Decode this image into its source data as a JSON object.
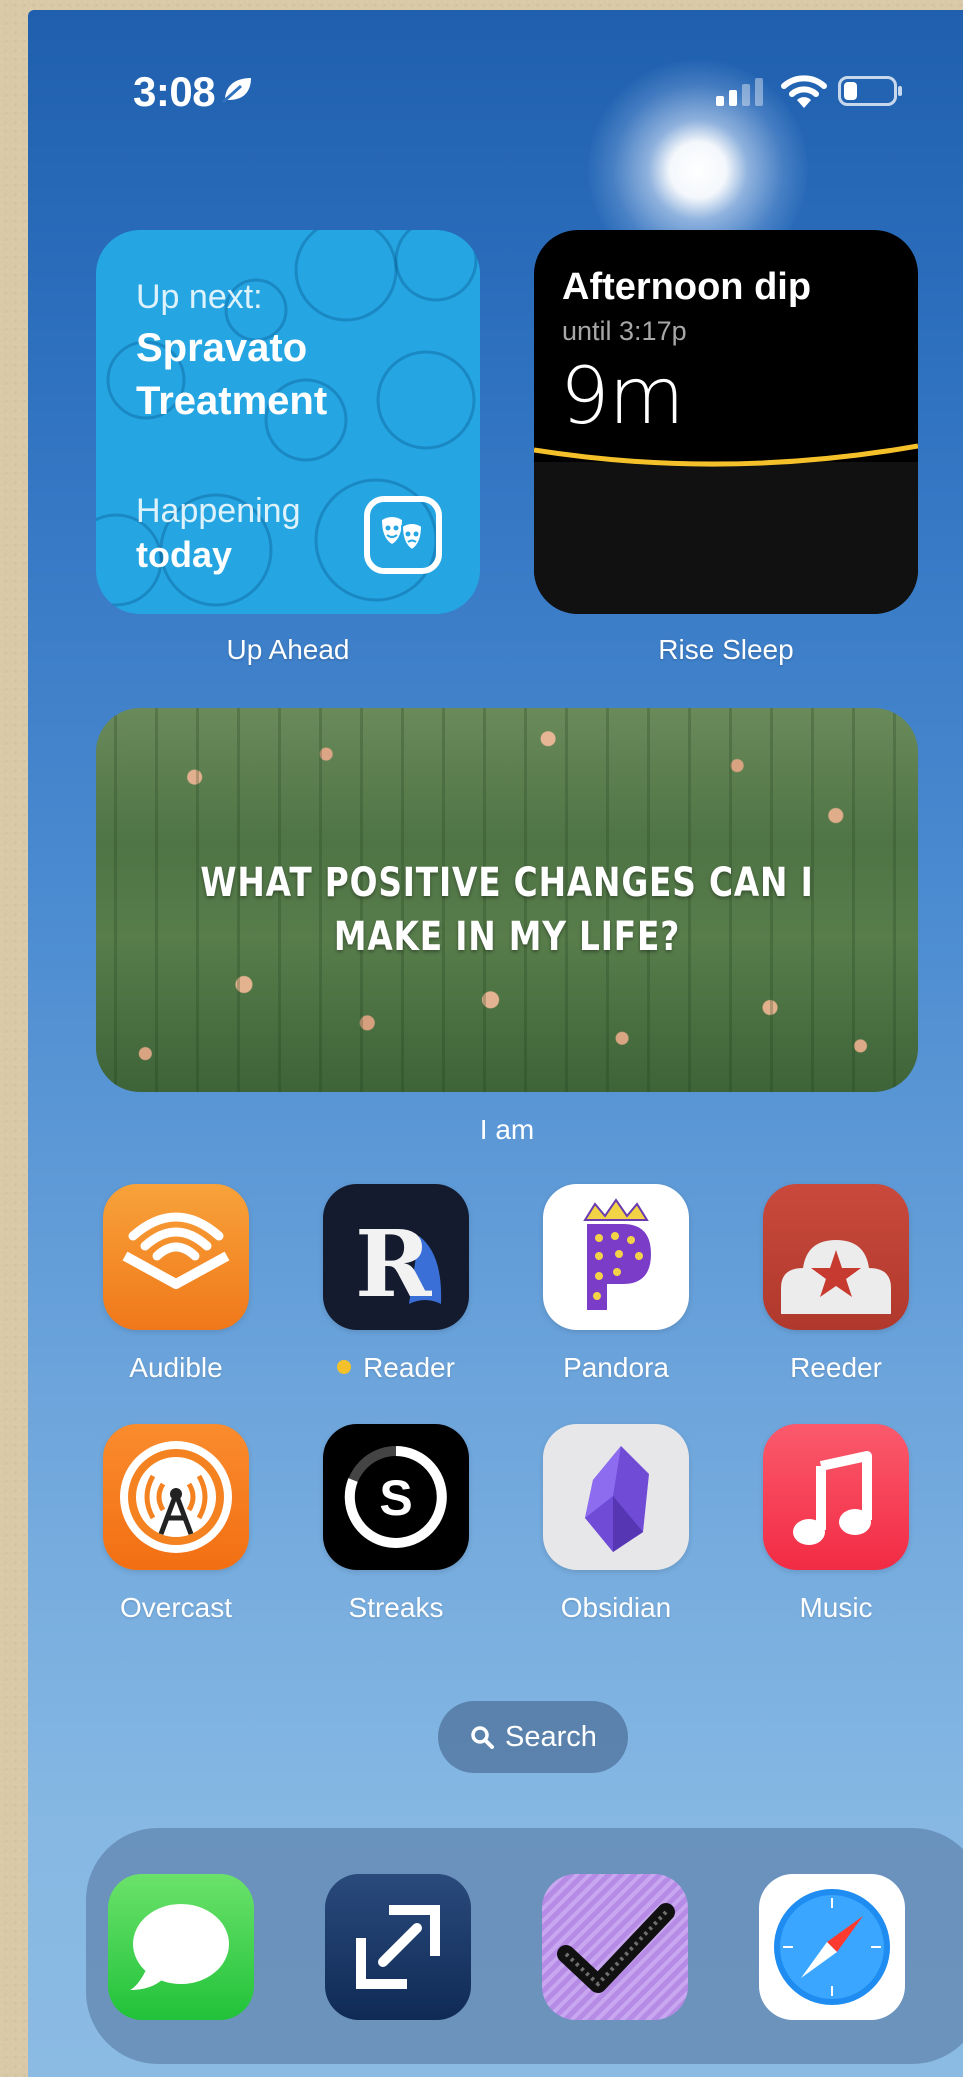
{
  "status_bar": {
    "time": "3:08",
    "focus_icon": "leaf-icon",
    "signal_bars": 4,
    "signal_active": 2,
    "battery_level": 0.2
  },
  "widgets": {
    "up_ahead": {
      "label": "Up Ahead",
      "heading": "Up next:",
      "event": "Spravato Treatment",
      "when_label": "Happening",
      "when_value": "today",
      "icon": "theater-masks-icon",
      "bg_color": "#25a6e3"
    },
    "rise_sleep": {
      "label": "Rise Sleep",
      "title": "Afternoon dip",
      "subtitle": "until 3:17p",
      "value": "9m",
      "curve_color": "#f5c12a"
    },
    "i_am": {
      "label": "I am",
      "quote": "What positive changes can I make in my life?"
    }
  },
  "apps_row1": [
    {
      "name": "Audible",
      "icon": "audible-icon"
    },
    {
      "name": "Reader",
      "icon": "reader-icon",
      "badge_dot": true
    },
    {
      "name": "Pandora",
      "icon": "pandora-icon"
    },
    {
      "name": "Reeder",
      "icon": "reeder-icon"
    }
  ],
  "apps_row2": [
    {
      "name": "Overcast",
      "icon": "overcast-icon"
    },
    {
      "name": "Streaks",
      "icon": "streaks-icon"
    },
    {
      "name": "Obsidian",
      "icon": "obsidian-icon"
    },
    {
      "name": "Music",
      "icon": "music-icon"
    }
  ],
  "search": {
    "label": "Search",
    "icon": "search-icon"
  },
  "dock": [
    {
      "icon": "messages-icon"
    },
    {
      "icon": "screens-icon"
    },
    {
      "icon": "omnifocus-check-icon"
    },
    {
      "icon": "safari-icon"
    }
  ]
}
